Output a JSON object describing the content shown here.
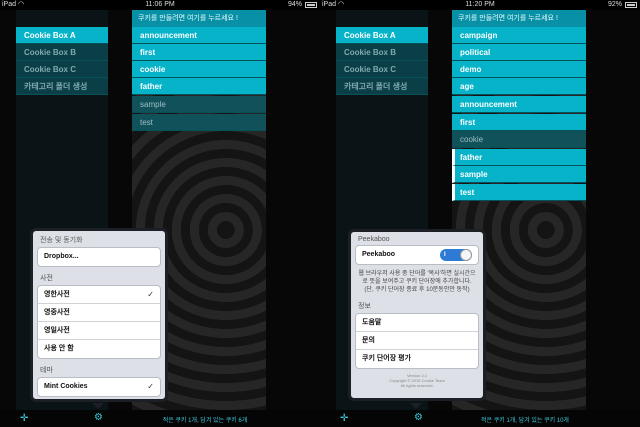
{
  "left": {
    "status": {
      "carrier": "iPad",
      "time": "11:06 PM",
      "battery": "94%"
    },
    "header": "쿠키를 만들려면 여기를 누르세요 !",
    "sidebar": [
      {
        "label": "Cookie Box A",
        "state": "active"
      },
      {
        "label": "Cookie Box B",
        "state": "dim"
      },
      {
        "label": "Cookie Box C",
        "state": "dim"
      },
      {
        "label": "카테고리 폴더 생성",
        "state": "dim"
      }
    ],
    "list": [
      {
        "label": "announcement",
        "state": "active"
      },
      {
        "label": "first",
        "state": "active"
      },
      {
        "label": "cookie",
        "state": "active"
      },
      {
        "label": "father",
        "state": "active"
      },
      {
        "label": "sample",
        "state": "muted"
      },
      {
        "label": "test",
        "state": "muted"
      }
    ],
    "popover": {
      "sync_section": "전송 및 동기화",
      "dropbox": "Dropbox...",
      "dict_section": "사전",
      "dictionaries": [
        {
          "label": "영한사전",
          "checked": true
        },
        {
          "label": "영중사전",
          "checked": false
        },
        {
          "label": "영일사전",
          "checked": false
        },
        {
          "label": "사용 안 함",
          "checked": false
        }
      ],
      "theme_section": "테마",
      "theme": {
        "label": "Mint Cookies",
        "checked": true
      }
    },
    "bottom": {
      "count": "적은 쿠키 1개, 담겨 있는 쿠키 6개"
    }
  },
  "right": {
    "status": {
      "carrier": "iPad",
      "time": "11:20 PM",
      "battery": "92%"
    },
    "header": "쿠키를 만들려면 여기를 누르세요 !",
    "sidebar": [
      {
        "label": "Cookie Box A",
        "state": "active"
      },
      {
        "label": "Cookie Box B",
        "state": "dim"
      },
      {
        "label": "Cookie Box C",
        "state": "dim"
      },
      {
        "label": "카테고리 폴더 생성",
        "state": "dim"
      }
    ],
    "list": [
      {
        "label": "campaign",
        "state": "active",
        "edge": false
      },
      {
        "label": "political",
        "state": "active",
        "edge": false
      },
      {
        "label": "demo",
        "state": "active",
        "edge": false
      },
      {
        "label": "age",
        "state": "active",
        "edge": false
      },
      {
        "label": "announcement",
        "state": "active",
        "edge": false
      },
      {
        "label": "first",
        "state": "active",
        "edge": false
      },
      {
        "label": "cookie",
        "state": "muted",
        "edge": false
      },
      {
        "label": "father",
        "state": "active",
        "edge": true
      },
      {
        "label": "sample",
        "state": "active",
        "edge": true
      },
      {
        "label": "test",
        "state": "active",
        "edge": true
      }
    ],
    "popover": {
      "peekaboo_section": "Peekaboo",
      "peekaboo_label": "Peekaboo",
      "toggle_label": "I",
      "note": "웹 브라우저 사용 중 단어를 '복사'하면 실시간으로 뜻을 보여주고 쿠키 단어장에 추가합니다. (단, 쿠키 단어장 종료 후 10분동안만 동작)",
      "info_section": "정보",
      "info": [
        "도움말",
        "문의",
        "쿠키 단어장 평가"
      ],
      "footer1": "Version 2.1",
      "footer2": "Copyright © 2010 Cookie Team",
      "footer3": "All rights reserved."
    },
    "bottom": {
      "count": "적은 쿠키 1개, 담겨 있는 쿠키 10개"
    }
  },
  "icons": {
    "add": "plus-icon",
    "settings": "gear-icon",
    "wifi": "wifi-icon",
    "battery": "battery-icon",
    "check": "checkmark-icon"
  },
  "colors": {
    "accent": "#06b3c9",
    "header": "#0891a6",
    "dim": "#0b3f47"
  }
}
